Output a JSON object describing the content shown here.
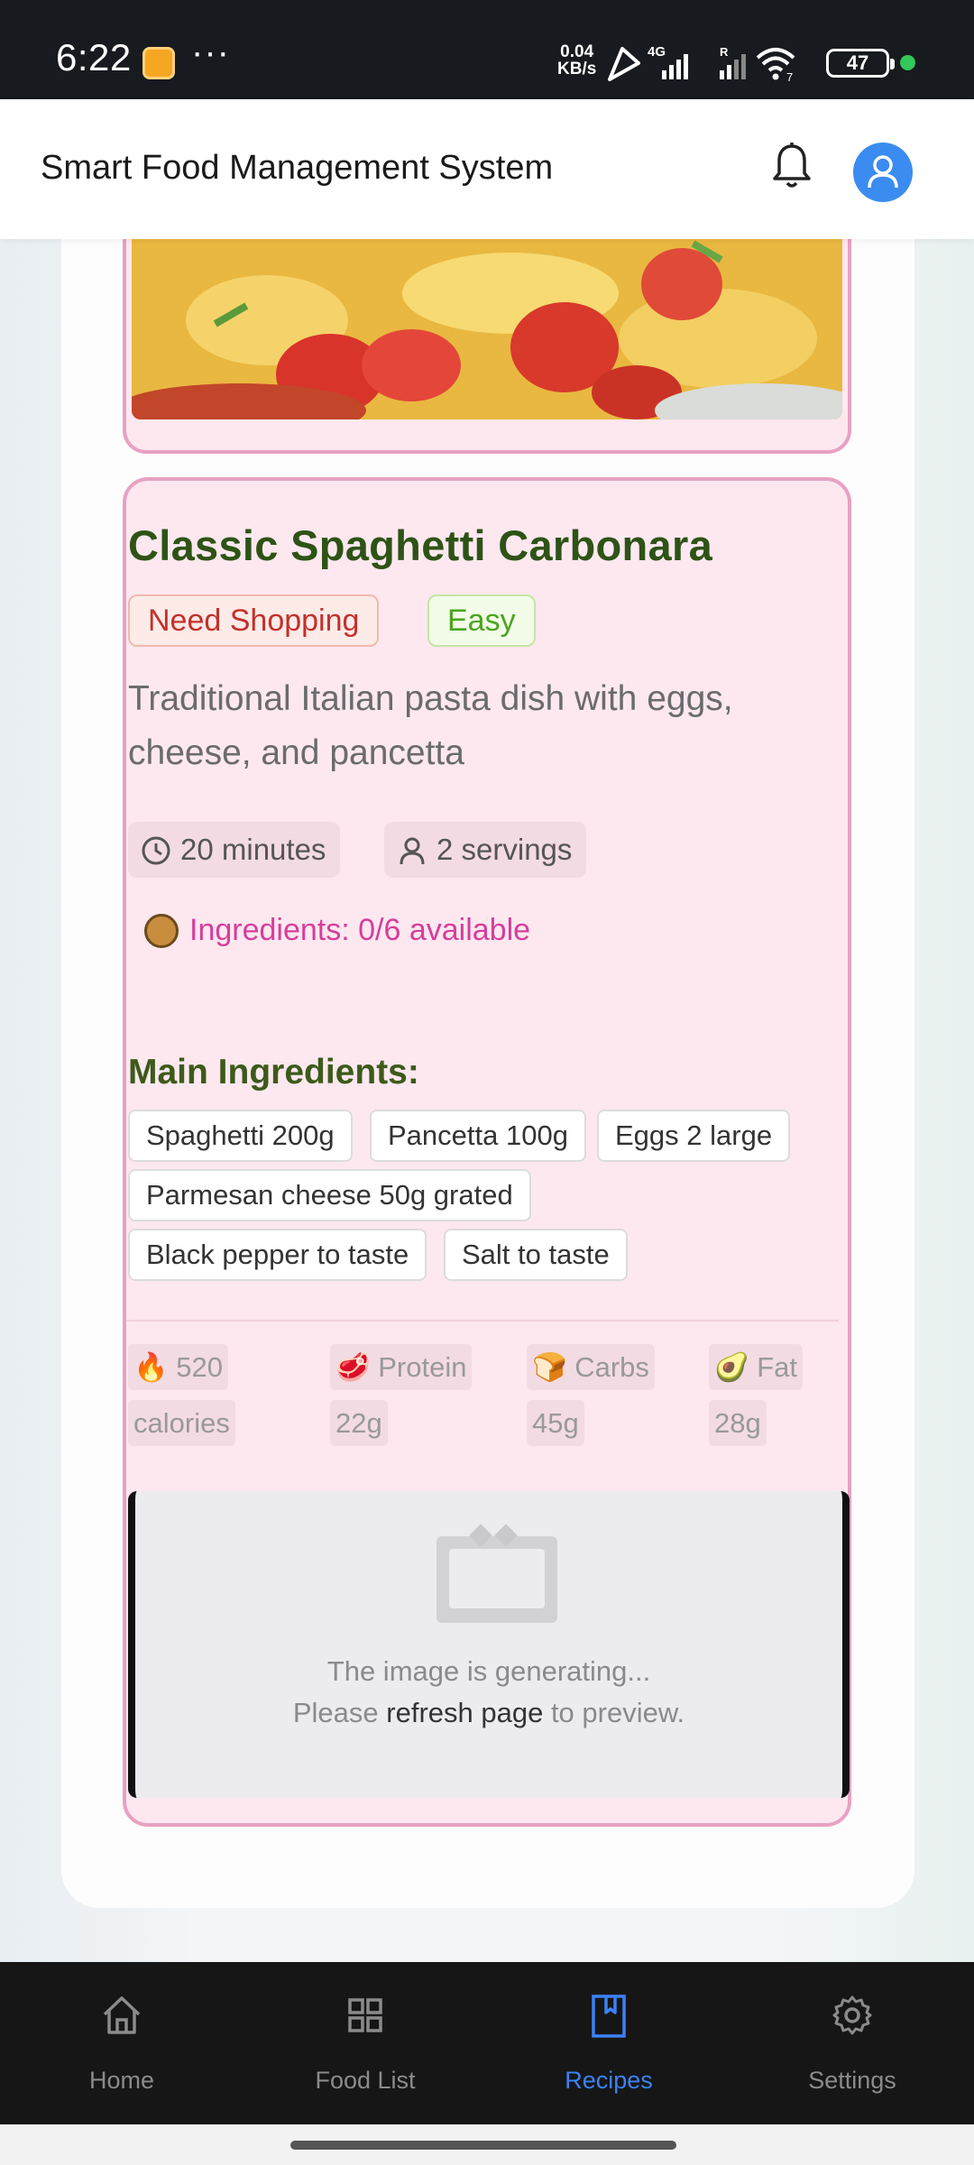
{
  "status_bar": {
    "time": "6:22",
    "more": "···",
    "net_speed_value": "0.04",
    "net_speed_unit": "KB/s",
    "network": "4G",
    "battery": "47"
  },
  "header": {
    "title": "Smart Food Management System"
  },
  "recipe": {
    "title": "Classic Spaghetti Carbonara",
    "tags": {
      "shopping": "Need Shopping",
      "difficulty": "Easy"
    },
    "description": "Traditional Italian pasta dish with eggs, cheese, and pancetta",
    "time": "20 minutes",
    "servings": "2 servings",
    "ingredients_status": "Ingredients: 0/6 available",
    "ingredients_heading": "Main Ingredients:",
    "ingredients": [
      "Spaghetti 200g",
      "Pancetta 100g",
      "Eggs 2 large",
      "Parmesan cheese 50g grated",
      "Black pepper to taste",
      "Salt to taste"
    ],
    "nutrition": {
      "calories_icon": "🔥",
      "calories_line1": "520",
      "calories_line2": "calories",
      "protein_icon": "🥩",
      "protein_line1": "Protein",
      "protein_line2": "22g",
      "carbs_icon": "🍞",
      "carbs_line1": "Carbs",
      "carbs_line2": "45g",
      "fat_icon": "🥑",
      "fat_line1": "Fat",
      "fat_line2": "28g"
    },
    "image_placeholder": {
      "line1": "The image is generating...",
      "line2_pre": "Please ",
      "line2_bold": "refresh page",
      "line2_post": " to preview."
    }
  },
  "bottom_nav": {
    "items": [
      {
        "label": "Home",
        "icon": "home-icon"
      },
      {
        "label": "Food List",
        "icon": "grid-icon"
      },
      {
        "label": "Recipes",
        "icon": "bookmark-icon"
      },
      {
        "label": "Settings",
        "icon": "gear-icon"
      }
    ],
    "active": "Recipes",
    "active_color": "#3b82f6"
  },
  "colors": {
    "card_bg": "#fde8f0",
    "card_border": "#e8a1c3",
    "title_green": "#2e5316",
    "status_pink": "#d63e9b",
    "avatar_blue": "#3b8cf0"
  }
}
